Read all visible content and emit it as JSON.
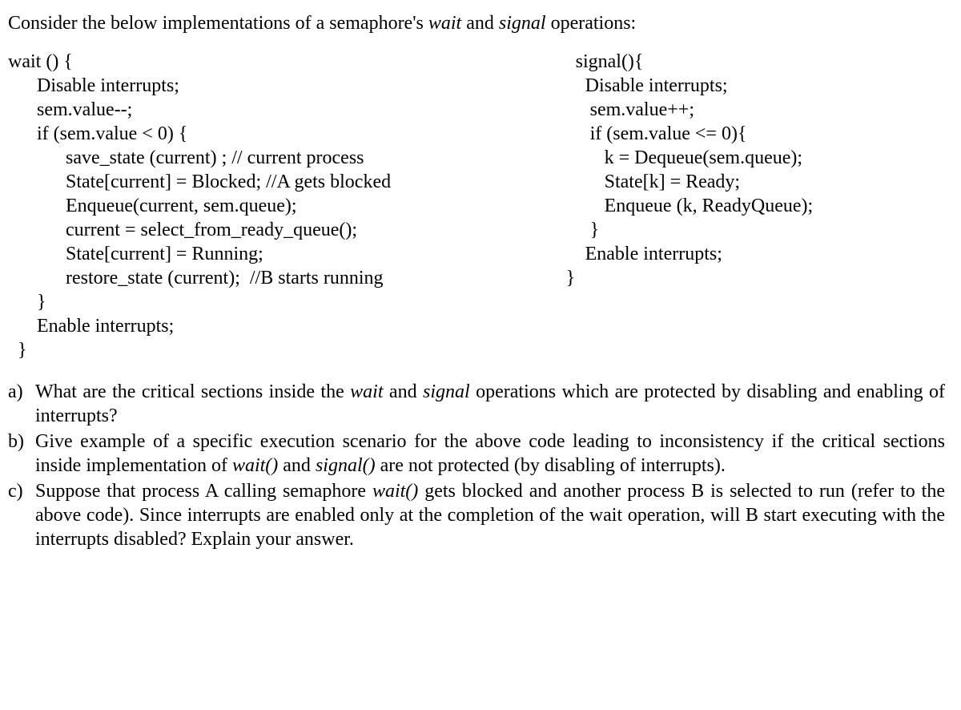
{
  "intro": {
    "before": "Consider the below implementations of a semaphore's ",
    "kw1": "wait",
    "mid": " and ",
    "kw2": "signal",
    "after": " operations:"
  },
  "wait_code": "wait () {\n      Disable interrupts;\n      sem.value--;\n      if (sem.value < 0) {\n            save_state (current) ; // current process\n            State[current] = Blocked; //A gets blocked\n            Enqueue(current, sem.queue);\n            current = select_from_ready_queue();\n            State[current] = Running;\n            restore_state (current);  //B starts running\n      }\n      Enable interrupts;\n  }",
  "signal_code": "     signal(){\n       Disable interrupts;\n        sem.value++;\n        if (sem.value <= 0){\n           k = Dequeue(sem.queue);\n           State[k] = Ready;\n           Enqueue (k, ReadyQueue);\n        }\n       Enable interrupts;\n   }",
  "q": {
    "a": {
      "label": "a)",
      "before": "What are the critical sections inside the ",
      "kw1": "wait",
      "mid1": " and ",
      "kw2": "signal",
      "after": " operations which are protected by disabling and enabling of interrupts?"
    },
    "b": {
      "label": "b)",
      "before": "Give example of a specific execution scenario for the above code leading to inconsistency if the critical sections inside implementation of ",
      "kw1": "wait()",
      "mid1": " and ",
      "kw2": "signal()",
      "after": " are not protected (by disabling of interrupts)."
    },
    "c": {
      "label": "c)",
      "before": "Suppose that process A calling semaphore ",
      "kw1": "wait()",
      "after": " gets blocked and another process B is selected to run (refer to the above code). Since interrupts are enabled only at the completion of the wait operation, will B start executing with the interrupts disabled? Explain your answer."
    }
  }
}
